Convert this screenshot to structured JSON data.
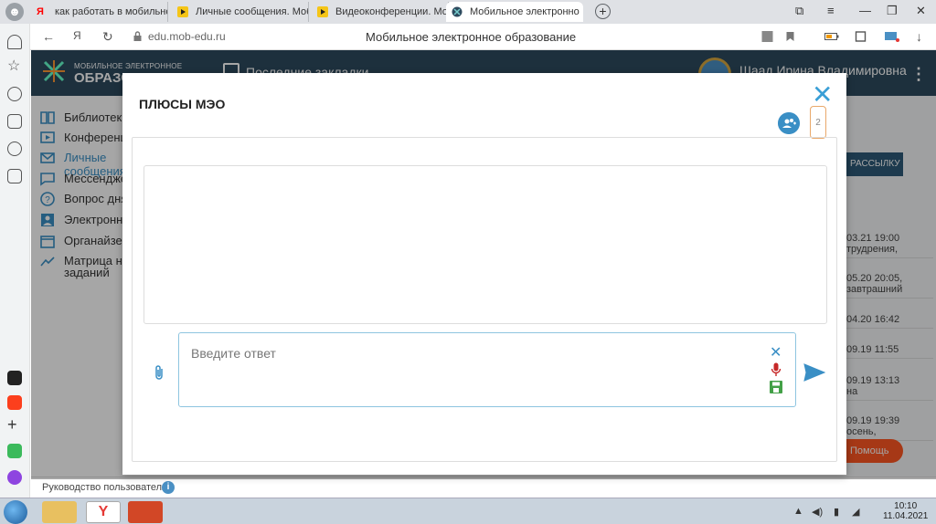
{
  "browser": {
    "tabs": [
      {
        "label": "как работать в мобильно",
        "active": false
      },
      {
        "label": "Личные сообщения. Моб",
        "active": false
      },
      {
        "label": "Видеоконференции. Моб",
        "active": false
      },
      {
        "label": "Мобильное электронно",
        "active": true
      }
    ],
    "url": "edu.mob-edu.ru",
    "page_title": "Мобильное электронное образование"
  },
  "app": {
    "logo_line1": "МОБИЛЬНОЕ ЭЛЕКТРОННОЕ",
    "logo_line2": "ОБРАЗОВАНИЕ",
    "bookmarks_label": "Последние закладки",
    "user_name": "Шаад Ирина Владимировна"
  },
  "sidebar": {
    "items": [
      {
        "label": "Библиотека",
        "icon": "book-icon"
      },
      {
        "label": "Конференции",
        "icon": "play-icon"
      },
      {
        "label": "Личные сообщения",
        "icon": "mail-icon"
      },
      {
        "label": "Мессенджер",
        "icon": "chat-icon"
      },
      {
        "label": "Вопрос дня",
        "icon": "question-icon"
      },
      {
        "label": "Электронный",
        "icon": "person-icon"
      },
      {
        "label": "Органайзер",
        "icon": "calendar-icon"
      },
      {
        "label": "Матрица на",
        "label2": "заданий",
        "icon": "trend-icon"
      }
    ]
  },
  "background": {
    "mailing_button": "РАССЫЛКУ",
    "rows": [
      {
        "date": "03.21 19:00",
        "text": "трудрения,"
      },
      {
        "date": "05.20 20:05,",
        "text": "завтрашний"
      },
      {
        "date": "04.20 16:42",
        "text": ""
      },
      {
        "date": "09.19 11:55",
        "text": ""
      },
      {
        "date": "09.19 13:13",
        "text": "на"
      },
      {
        "date": "09.19 19:39",
        "text": "осень,"
      }
    ],
    "help_button": "Помощь"
  },
  "footer": {
    "user_guide": "Руководство пользователя",
    "info": "i"
  },
  "modal": {
    "title": "ПЛЮСЫ МЭО",
    "close": "✕",
    "participants_count": "2",
    "reply_placeholder": "Введите ответ",
    "clear": "✕"
  },
  "taskbar": {
    "time": "10:10",
    "date": "11.04.2021"
  },
  "colors": {
    "accent": "#3a8fc5",
    "header": "#2d4a5e",
    "help": "#ff5722"
  }
}
